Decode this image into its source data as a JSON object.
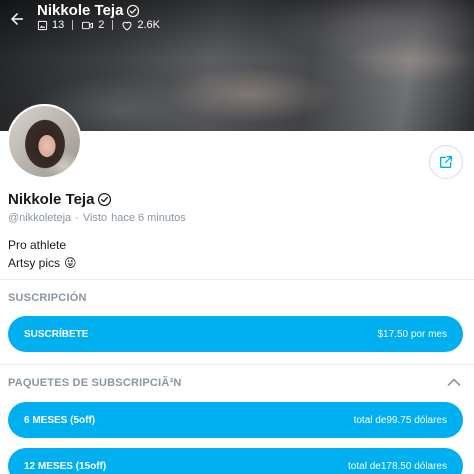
{
  "header": {
    "title": "Nikkole Teja",
    "stats": {
      "photos": "13",
      "videos": "2",
      "likes": "2.6K"
    }
  },
  "profile": {
    "name": "Nikkole Teja",
    "handle": "@nikkoleteja",
    "status_label": "Visto",
    "last_seen": "hace 6 minutos",
    "bio_line1": "Pro athlete",
    "bio_line2": "Artsy pics",
    "bio_emoji": "😜"
  },
  "subscription": {
    "title": "SUSCRIPCIÓN",
    "button_label": "SUSCRÍBETE",
    "button_price": "$17.50 por mes"
  },
  "bundles": {
    "title": "PAQUETES DE SUBSCRIPCIÃ³N",
    "items": [
      {
        "label": "6 MESES (5off)",
        "total": "total de99.75 dólares"
      },
      {
        "label": "12 MESES (15off)",
        "total": "total de178.50 dólares"
      }
    ]
  },
  "colors": {
    "accent": "#00aff0",
    "muted": "#8a96a3",
    "divider": "#e6eaee"
  },
  "icons": {
    "back": "arrow-left-icon",
    "verified": "verified-badge-icon",
    "photos": "image-icon",
    "videos": "video-icon",
    "likes": "heart-icon",
    "share": "share-icon",
    "collapse": "chevron-up-icon"
  }
}
